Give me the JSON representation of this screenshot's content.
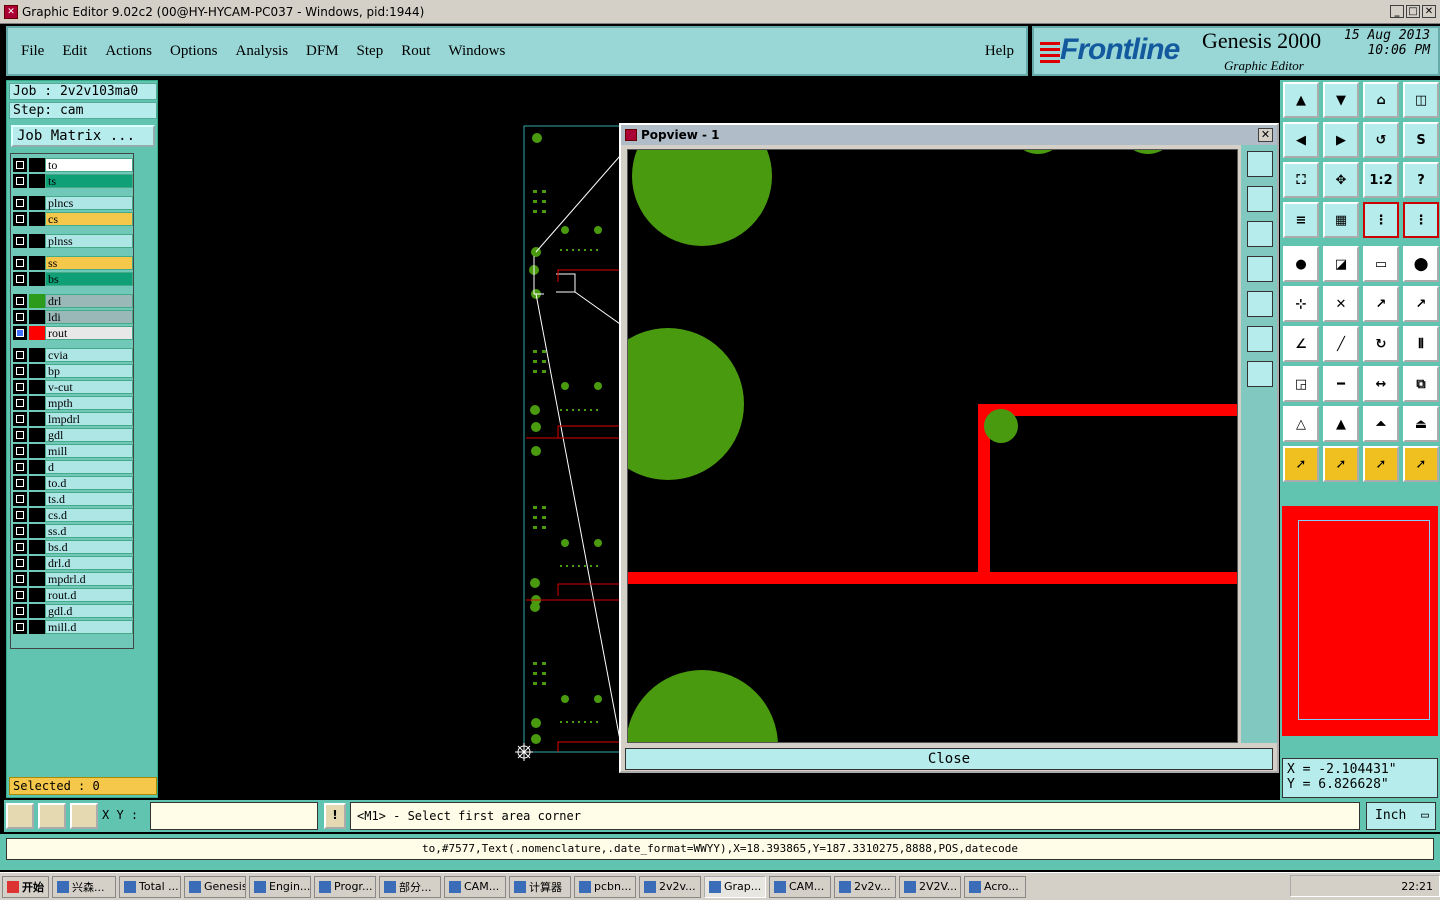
{
  "window": {
    "title": "Graphic Editor 9.02c2 (00@HY-HYCAM-PC037 - Windows, pid:1944)"
  },
  "menu": {
    "items": [
      "File",
      "Edit",
      "Actions",
      "Options",
      "Analysis",
      "DFM",
      "Step",
      "Rout",
      "Windows"
    ],
    "help": "Help"
  },
  "brand": {
    "logo": "Frontline",
    "product": "Genesis 2000",
    "subtitle": "Graphic Editor",
    "date": "15 Aug 2013",
    "time": "10:06 PM"
  },
  "job": {
    "job_line": "Job  : 2v2v103ma0",
    "step_line": "Step: cam",
    "matrix_button": "Job Matrix ..."
  },
  "layers": [
    {
      "name": "to",
      "color": "#ffffff",
      "swatch": "#000000"
    },
    {
      "name": "ts",
      "color": "#10a078",
      "swatch": "#000000"
    },
    {
      "name": "plncs",
      "color": "#aee6e6",
      "swatch": "#000000"
    },
    {
      "name": "cs",
      "color": "#f5c74a",
      "swatch": "#000000"
    },
    {
      "name": "plnss",
      "color": "#aee6e6",
      "swatch": "#000000"
    },
    {
      "name": "ss",
      "color": "#f5c74a",
      "swatch": "#000000"
    },
    {
      "name": "bs",
      "color": "#10a078",
      "swatch": "#000000"
    },
    {
      "name": "drl",
      "color": "#9ab8b8",
      "swatch": "#2c9a1a"
    },
    {
      "name": "ldi",
      "color": "#9ab8b8",
      "swatch": "#000000"
    },
    {
      "name": "rout",
      "color": "#e8e8e8",
      "swatch": "#ff0000",
      "checked": true
    },
    {
      "name": "cvia",
      "color": "#aee6e6",
      "swatch": "#000000"
    },
    {
      "name": "bp",
      "color": "#aee6e6",
      "swatch": "#000000"
    },
    {
      "name": "v-cut",
      "color": "#aee6e6",
      "swatch": "#000000"
    },
    {
      "name": "mpth",
      "color": "#aee6e6",
      "swatch": "#000000"
    },
    {
      "name": "lmpdrl",
      "color": "#aee6e6",
      "swatch": "#000000"
    },
    {
      "name": "gdl",
      "color": "#aee6e6",
      "swatch": "#000000"
    },
    {
      "name": "mill",
      "color": "#aee6e6",
      "swatch": "#000000"
    },
    {
      "name": "d",
      "color": "#aee6e6",
      "swatch": "#000000"
    },
    {
      "name": "to.d",
      "color": "#aee6e6",
      "swatch": "#000000"
    },
    {
      "name": "ts.d",
      "color": "#aee6e6",
      "swatch": "#000000"
    },
    {
      "name": "cs.d",
      "color": "#aee6e6",
      "swatch": "#000000"
    },
    {
      "name": "ss.d",
      "color": "#aee6e6",
      "swatch": "#000000"
    },
    {
      "name": "bs.d",
      "color": "#aee6e6",
      "swatch": "#000000"
    },
    {
      "name": "drl.d",
      "color": "#aee6e6",
      "swatch": "#000000"
    },
    {
      "name": "mpdrl.d",
      "color": "#aee6e6",
      "swatch": "#000000"
    },
    {
      "name": "rout.d",
      "color": "#aee6e6",
      "swatch": "#000000"
    },
    {
      "name": "gdl.d",
      "color": "#aee6e6",
      "swatch": "#000000"
    },
    {
      "name": "mill.d",
      "color": "#aee6e6",
      "swatch": "#000000"
    }
  ],
  "selected": "Selected : 0",
  "popview": {
    "title": "Popview - 1",
    "close_label": "Close"
  },
  "coords": {
    "x": "X  =  -2.104431\"",
    "y": "Y  =  6.826628\""
  },
  "command": {
    "xy_label": "X Y :",
    "xy_value": "",
    "prompt": "<M1> - Select first area corner",
    "unit": "Inch"
  },
  "status_line": "to,#7577,Text(.nomenclature,.date_format=WWYY),X=18.393865,Y=187.3310275,8888,POS,datecode",
  "taskbar": {
    "start": "开始",
    "tasks": [
      "兴森...",
      "Total ...",
      "Genesis",
      "Engin...",
      "Progr...",
      "部分...",
      "CAM...",
      "计算器",
      "pcbn...",
      "2v2v...",
      "Grap...",
      "CAM...",
      "2v2v...",
      "2V2V...",
      "Acro..."
    ],
    "active_task": "Grap...",
    "clock": "22:21"
  },
  "colors": {
    "panel": "#60c4b0",
    "field": "#b6ecec",
    "pad": "#4a9a10",
    "rout": "#ff0000"
  }
}
